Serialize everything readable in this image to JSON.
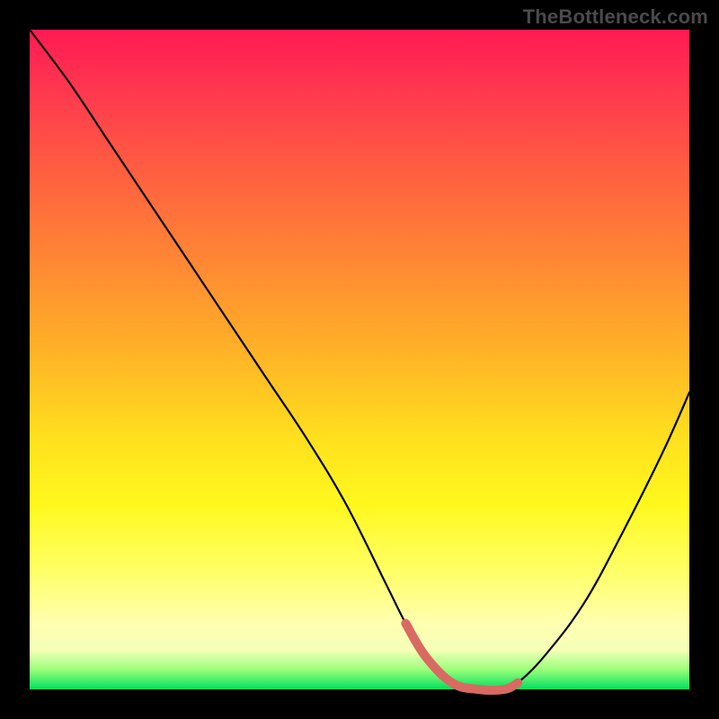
{
  "watermark": "TheBottleneck.com",
  "colors": {
    "background": "#000000",
    "curve": "#000000",
    "highlight": "#d86a62",
    "watermark_text": "#4a4a4a"
  },
  "chart_data": {
    "type": "line",
    "title": "",
    "xlabel": "",
    "ylabel": "",
    "xlim": [
      0,
      100
    ],
    "ylim": [
      0,
      100
    ],
    "grid": false,
    "legend": false,
    "series": [
      {
        "name": "bottleneck-curve",
        "x": [
          0,
          6,
          12,
          18,
          24,
          30,
          36,
          42,
          48,
          54,
          57,
          60,
          64,
          68,
          72,
          74,
          78,
          84,
          90,
          96,
          100
        ],
        "values": [
          100,
          92,
          83,
          74,
          65,
          56,
          47,
          38,
          28,
          16,
          10,
          5,
          1,
          0,
          0,
          1,
          5,
          13,
          24,
          36,
          45
        ]
      },
      {
        "name": "highlight-segment",
        "x": [
          57,
          60,
          64,
          68,
          72,
          74
        ],
        "values": [
          10,
          5,
          1,
          0,
          0,
          1
        ]
      }
    ],
    "annotations": []
  }
}
